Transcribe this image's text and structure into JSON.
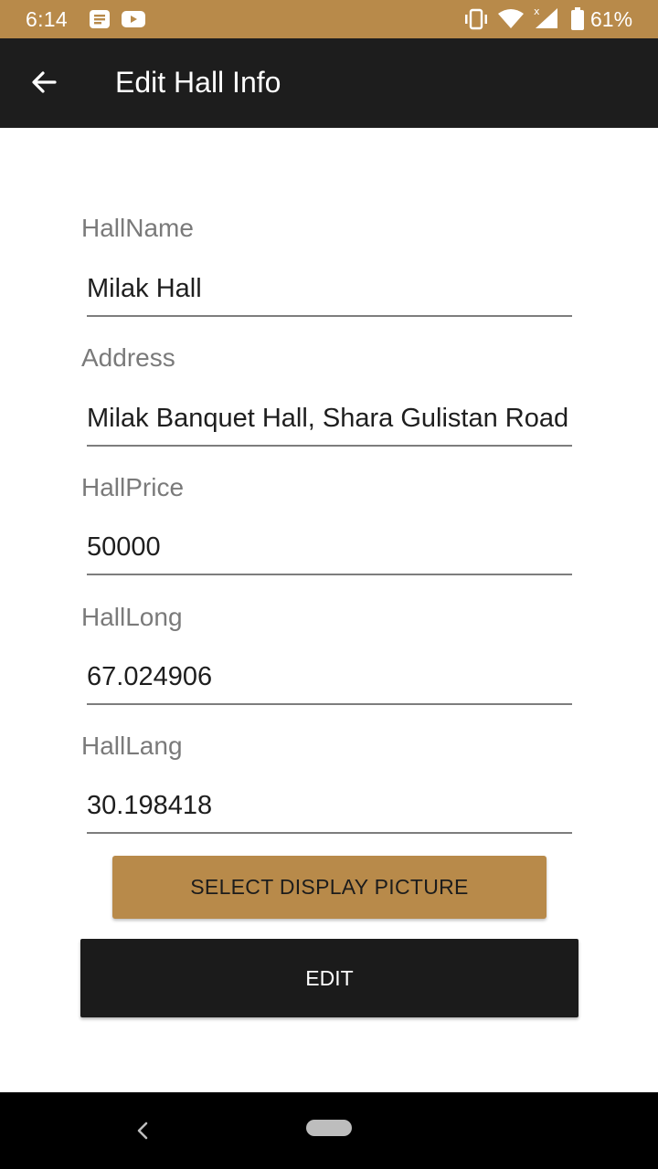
{
  "status_bar": {
    "time": "6:14",
    "battery_percent": "61%",
    "icons": [
      "notes-icon",
      "youtube-icon",
      "vibrate-icon",
      "wifi-icon",
      "signal-icon",
      "battery-icon"
    ],
    "color": "#b88a4a"
  },
  "app_bar": {
    "title": "Edit Hall Info",
    "back_icon": "arrow-back-icon",
    "color": "#1d1d1d"
  },
  "form": {
    "fields": [
      {
        "label": "HallName",
        "value": "Milak Hall"
      },
      {
        "label": "Address",
        "value": "Milak Banquet Hall, Shara Gulistan Road"
      },
      {
        "label": "HallPrice",
        "value": "50000"
      },
      {
        "label": "HallLong",
        "value": "67.024906"
      },
      {
        "label": "HallLang",
        "value": "30.198418"
      }
    ]
  },
  "buttons": {
    "select_picture": "SELECT DISPLAY PICTURE",
    "edit": "EDIT",
    "accent_color": "#b88a4a"
  },
  "nav_bar": {
    "back_icon": "nav-back-icon",
    "home_icon": "nav-home-pill"
  }
}
